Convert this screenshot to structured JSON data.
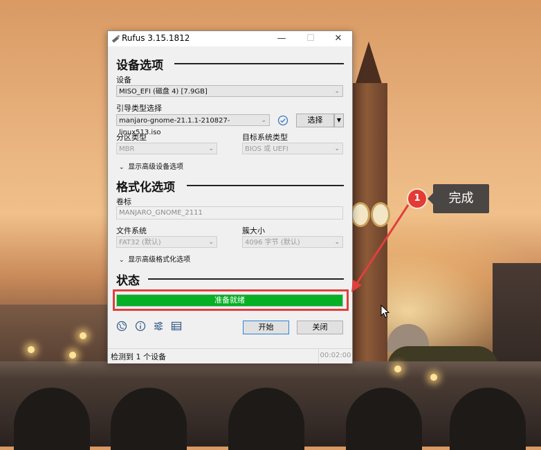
{
  "window": {
    "title": "Rufus 3.15.1812",
    "controls": {
      "minimize": "—",
      "maximize": "☐",
      "close": "✕"
    }
  },
  "device_options": {
    "heading": "设备选项",
    "device_label": "设备",
    "device_value": "MISO_EFI (磁盘 4) [7.9GB]",
    "boot_label": "引导类型选择",
    "boot_value": "manjaro-gnome-21.1.1-210827-linux513.iso",
    "select_button": "选择",
    "partition_label": "分区类型",
    "partition_value": "MBR",
    "target_label": "目标系统类型",
    "target_value": "BIOS 或 UEFI",
    "advanced_toggle": "显示高级设备选项"
  },
  "format_options": {
    "heading": "格式化选项",
    "volume_label": "卷标",
    "volume_value": "MANJARO_GNOME_2111",
    "fs_label": "文件系统",
    "fs_value": "FAT32 (默认)",
    "cluster_label": "簇大小",
    "cluster_value": "4096 字节 (默认)",
    "advanced_toggle": "显示高级格式化选项"
  },
  "status": {
    "heading": "状态",
    "progress_text": "准备就绪",
    "progress_fraction": 1.0
  },
  "actions": {
    "start": "开始",
    "close": "关闭"
  },
  "statusbar": {
    "text": "检测到 1 个设备",
    "timer": "00:02:00"
  },
  "annotation": {
    "number": "1",
    "label": "完成"
  },
  "colors": {
    "progress_green": "#06b025",
    "annotation_red": "#e0403c",
    "callout_bg": "#4a4644"
  }
}
